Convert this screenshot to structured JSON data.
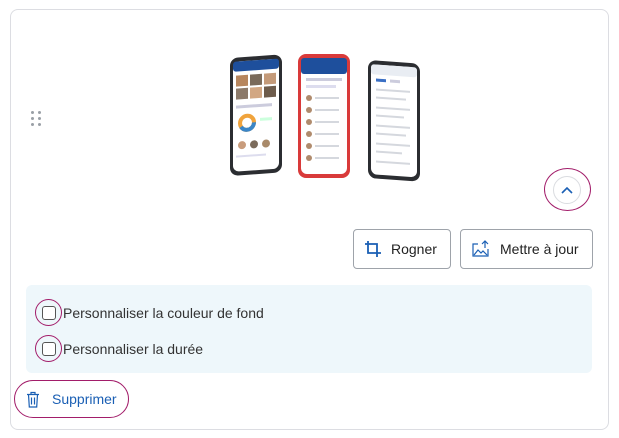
{
  "toolbar": {
    "crop_label": "Rogner",
    "update_label": "Mettre à jour"
  },
  "options": {
    "background_label": "Personnaliser la couleur de fond",
    "duration_label": "Personnaliser la durée"
  },
  "actions": {
    "delete_label": "Supprimer"
  },
  "icons": {
    "drag": "drag-handle-icon",
    "collapse": "chevron-up-icon",
    "crop": "crop-icon",
    "update": "image-upload-icon",
    "delete": "trash-icon"
  },
  "colors": {
    "accent_ring": "#a21d6a",
    "link_blue": "#1a5fb4",
    "options_bg": "#eef7fb",
    "phone_red": "#d93a3a"
  }
}
